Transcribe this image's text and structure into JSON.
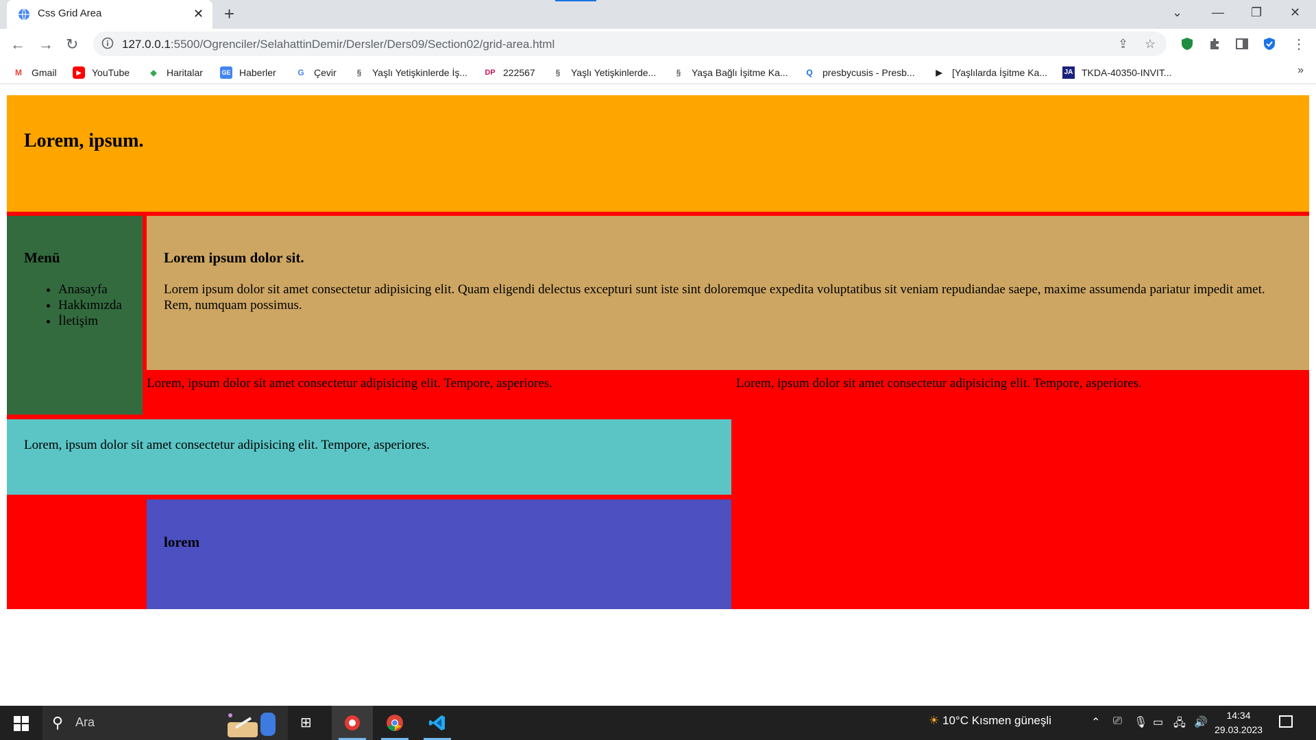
{
  "browser": {
    "tab_title": "Css Grid Area",
    "new_tab": "+",
    "url_host": "127.0.0.1",
    "url_rest": ":5500/Ogrenciler/SelahattinDemir/Dersler/Ders09/Section02/grid-area.html",
    "bookmarks": [
      {
        "label": "Gmail",
        "icon": "gmail-icon",
        "color": "#ea4335"
      },
      {
        "label": "YouTube",
        "icon": "youtube-icon",
        "color": "#ff0000"
      },
      {
        "label": "Haritalar",
        "icon": "maps-icon",
        "color": "#34a853"
      },
      {
        "label": "Haberler",
        "icon": "news-icon",
        "color": "#4285f4"
      },
      {
        "label": "Çevir",
        "icon": "translate-icon",
        "color": "#4285f4"
      },
      {
        "label": "Yaşlı Yetişkinlerde İş...",
        "icon": "link-icon",
        "color": "#5f6368"
      },
      {
        "label": "222567",
        "icon": "dp-icon",
        "color": "#c2185b"
      },
      {
        "label": "Yaşlı Yetişkinlerde...",
        "icon": "link-icon",
        "color": "#5f6368"
      },
      {
        "label": "Yaşa Bağlı İşitme Ka...",
        "icon": "link-icon",
        "color": "#5f6368"
      },
      {
        "label": "presbycusis - Presb...",
        "icon": "search-q-icon",
        "color": "#1a73e8"
      },
      {
        "label": "[Yaşlılarda İşitme Ka...",
        "icon": "bookmark-d-icon",
        "color": "#202124"
      },
      {
        "label": "TKDA-40350-INVIT...",
        "icon": "ja-icon",
        "color": "#1a237e"
      }
    ],
    "more_bookmarks": "»"
  },
  "page": {
    "header_title": "Lorem, ipsum.",
    "menu_title": "Menü",
    "menu_items": [
      "Anasayfa",
      "Hakkımızda",
      "İletişim"
    ],
    "main_title": "Lorem ipsum dolor sit.",
    "main_text": "Lorem ipsum dolor sit amet consectetur adipisicing elit. Quam eligendi delectus excepturi sunt iste sint doloremque expedita voluptatibus sit veniam repudiandae saepe, maxime assumenda pariatur impedit amet. Rem, numquam possimus.",
    "content1": "Lorem, ipsum dolor sit amet consectetur adipisicing elit. Tempore, asperiores.",
    "content2": "Lorem, ipsum dolor sit amet consectetur adipisicing elit. Tempore, asperiores.",
    "ad_text": "Lorem, ipsum dolor sit amet consectetur adipisicing elit. Tempore, asperiores.",
    "footer_title": "lorem",
    "colors": {
      "container": "#ff0000",
      "header": "#ffa500",
      "sidebar": "#336b3f",
      "main": "#cda663",
      "ad": "#5bc5c6",
      "footer": "#4c50c0"
    }
  },
  "taskbar": {
    "search_placeholder": "Ara",
    "weather": "10°C  Kısmen güneşli",
    "time": "14:34",
    "date": "29.03.2023"
  }
}
